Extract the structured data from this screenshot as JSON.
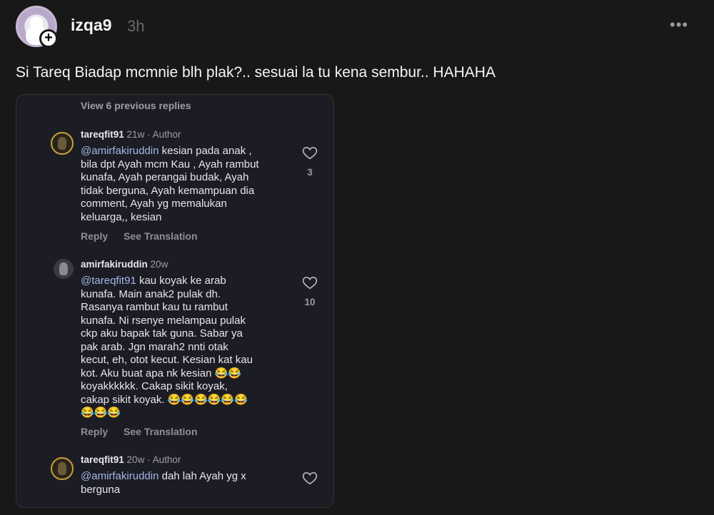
{
  "post": {
    "username": "izqa9",
    "time": "3h",
    "more_icon": "more-horizontal-icon",
    "caption": "Si Tareq Biadap mcmnie blh plak?.. sesuai la tu kena sembur.. HAHAHA"
  },
  "screenshot": {
    "view_previous": "View 6 previous replies",
    "comments": [
      {
        "username": "tareqfit91",
        "meta": "21w · Author",
        "mention": "@amirfakiruddin",
        "lines": [
          "kesian pada anak ,",
          "bila dpt Ayah mcm Kau , Ayah rambut",
          "kunafa, Ayah perangai budak, Ayah",
          "tidak berguna, Ayah kemampuan dia",
          "comment, Ayah yg memalukan",
          "keluarga,, kesian"
        ],
        "likes": "3",
        "reply": "Reply",
        "translate": "See Translation"
      },
      {
        "username": "amirfakiruddin",
        "meta": "20w",
        "mention": "@tareqfit91",
        "lines": [
          "kau koyak ke arab",
          "kunafa. Main anak2 pulak dh.",
          "Rasanya rambut kau tu rambut",
          "kunafa. Ni rsenye melampau pulak",
          "ckp aku bapak tak guna. Sabar ya",
          "pak arab. Jgn marah2 nnti otak",
          "kecut, eh, otot kecut. Kesian kat kau",
          "kot. Aku buat apa nk kesian 😂😂",
          "koyakkkkkk. Cakap sikit koyak,",
          "cakap sikit koyak. 😂😂😂😂😂😂",
          "😂😂😂"
        ],
        "likes": "10",
        "reply": "Reply",
        "translate": "See Translation"
      },
      {
        "username": "tareqfit91",
        "meta": "20w · Author",
        "mention": "@amirfakiruddin",
        "lines": [
          "dah lah Ayah yg x",
          "berguna"
        ]
      }
    ]
  },
  "colors": {
    "background": "#181818",
    "card": "#1c1d24",
    "mention": "#a3b7e8",
    "muted": "#9c9ca8"
  }
}
